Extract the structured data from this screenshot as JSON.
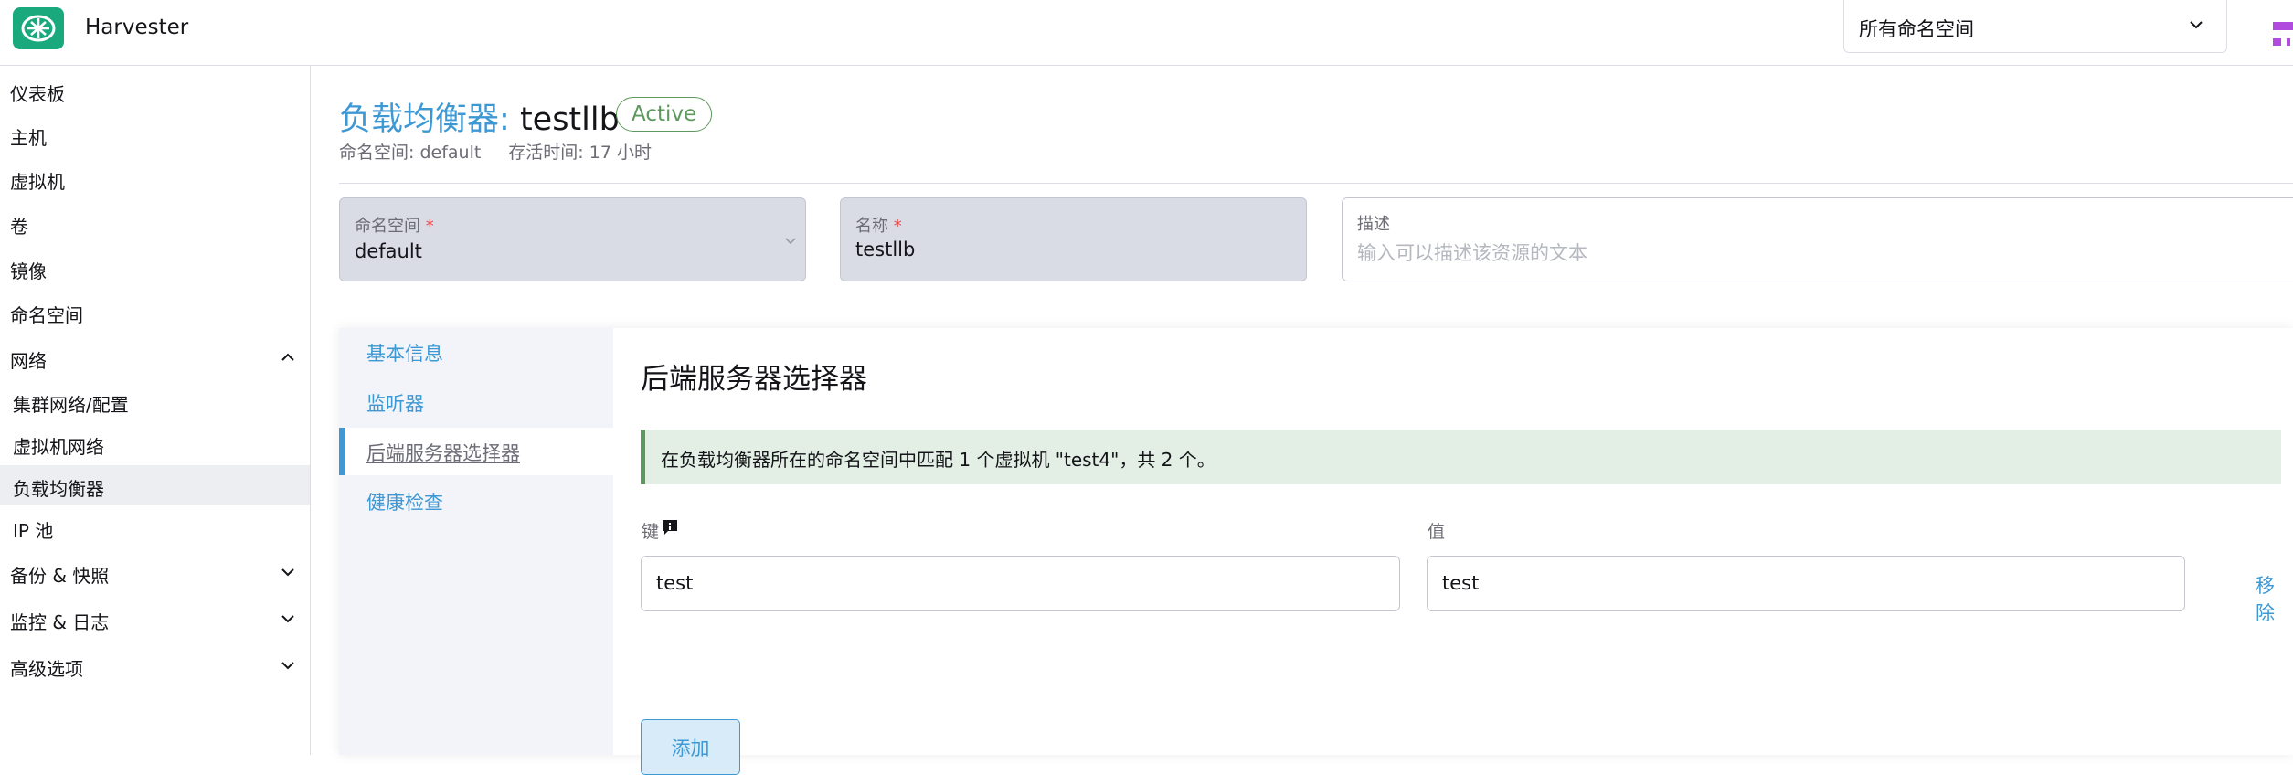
{
  "header": {
    "app_title": "Harvester",
    "namespace_select": "所有命名空间",
    "colors": {
      "brand": "#1aa97d",
      "accent": "#3d98d3",
      "active": "#5d995d"
    }
  },
  "sidebar": {
    "items": [
      {
        "label": "仪表板"
      },
      {
        "label": "主机"
      },
      {
        "label": "虚拟机"
      },
      {
        "label": "卷"
      },
      {
        "label": "镜像"
      },
      {
        "label": "命名空间"
      },
      {
        "label": "网络",
        "expanded": true
      },
      {
        "label": "集群网络/配置"
      },
      {
        "label": "虚拟机网络"
      },
      {
        "label": "负载均衡器",
        "active": true
      },
      {
        "label": "IP 池"
      },
      {
        "label": "备份 & 快照",
        "expanded": false
      },
      {
        "label": "监控 & 日志",
        "expanded": false
      },
      {
        "label": "高级选项",
        "expanded": false
      }
    ]
  },
  "page": {
    "crumb": "负载均衡器:",
    "name": "testllb",
    "status": "Active",
    "namespace_meta": "命名空间: default",
    "age_meta": "存活时间: 17 小时"
  },
  "form": {
    "namespace": {
      "label": "命名空间",
      "required": "*",
      "value": "default"
    },
    "name": {
      "label": "名称",
      "required": "*",
      "value": "testllb"
    },
    "description": {
      "label": "描述",
      "placeholder": "输入可以描述该资源的文本"
    }
  },
  "tabs": [
    {
      "label": "基本信息"
    },
    {
      "label": "监听器"
    },
    {
      "label": "后端服务器选择器",
      "active": true
    },
    {
      "label": "健康检查"
    }
  ],
  "selector": {
    "title": "后端服务器选择器",
    "banner": "在负载均衡器所在的命名空间中匹配 1 个虚拟机 \"test4\"，共 2 个。",
    "key_label": "键",
    "value_label": "值",
    "rows": [
      {
        "key": "test",
        "value": "test"
      }
    ],
    "remove_label": "移除",
    "add_label": "添加"
  }
}
